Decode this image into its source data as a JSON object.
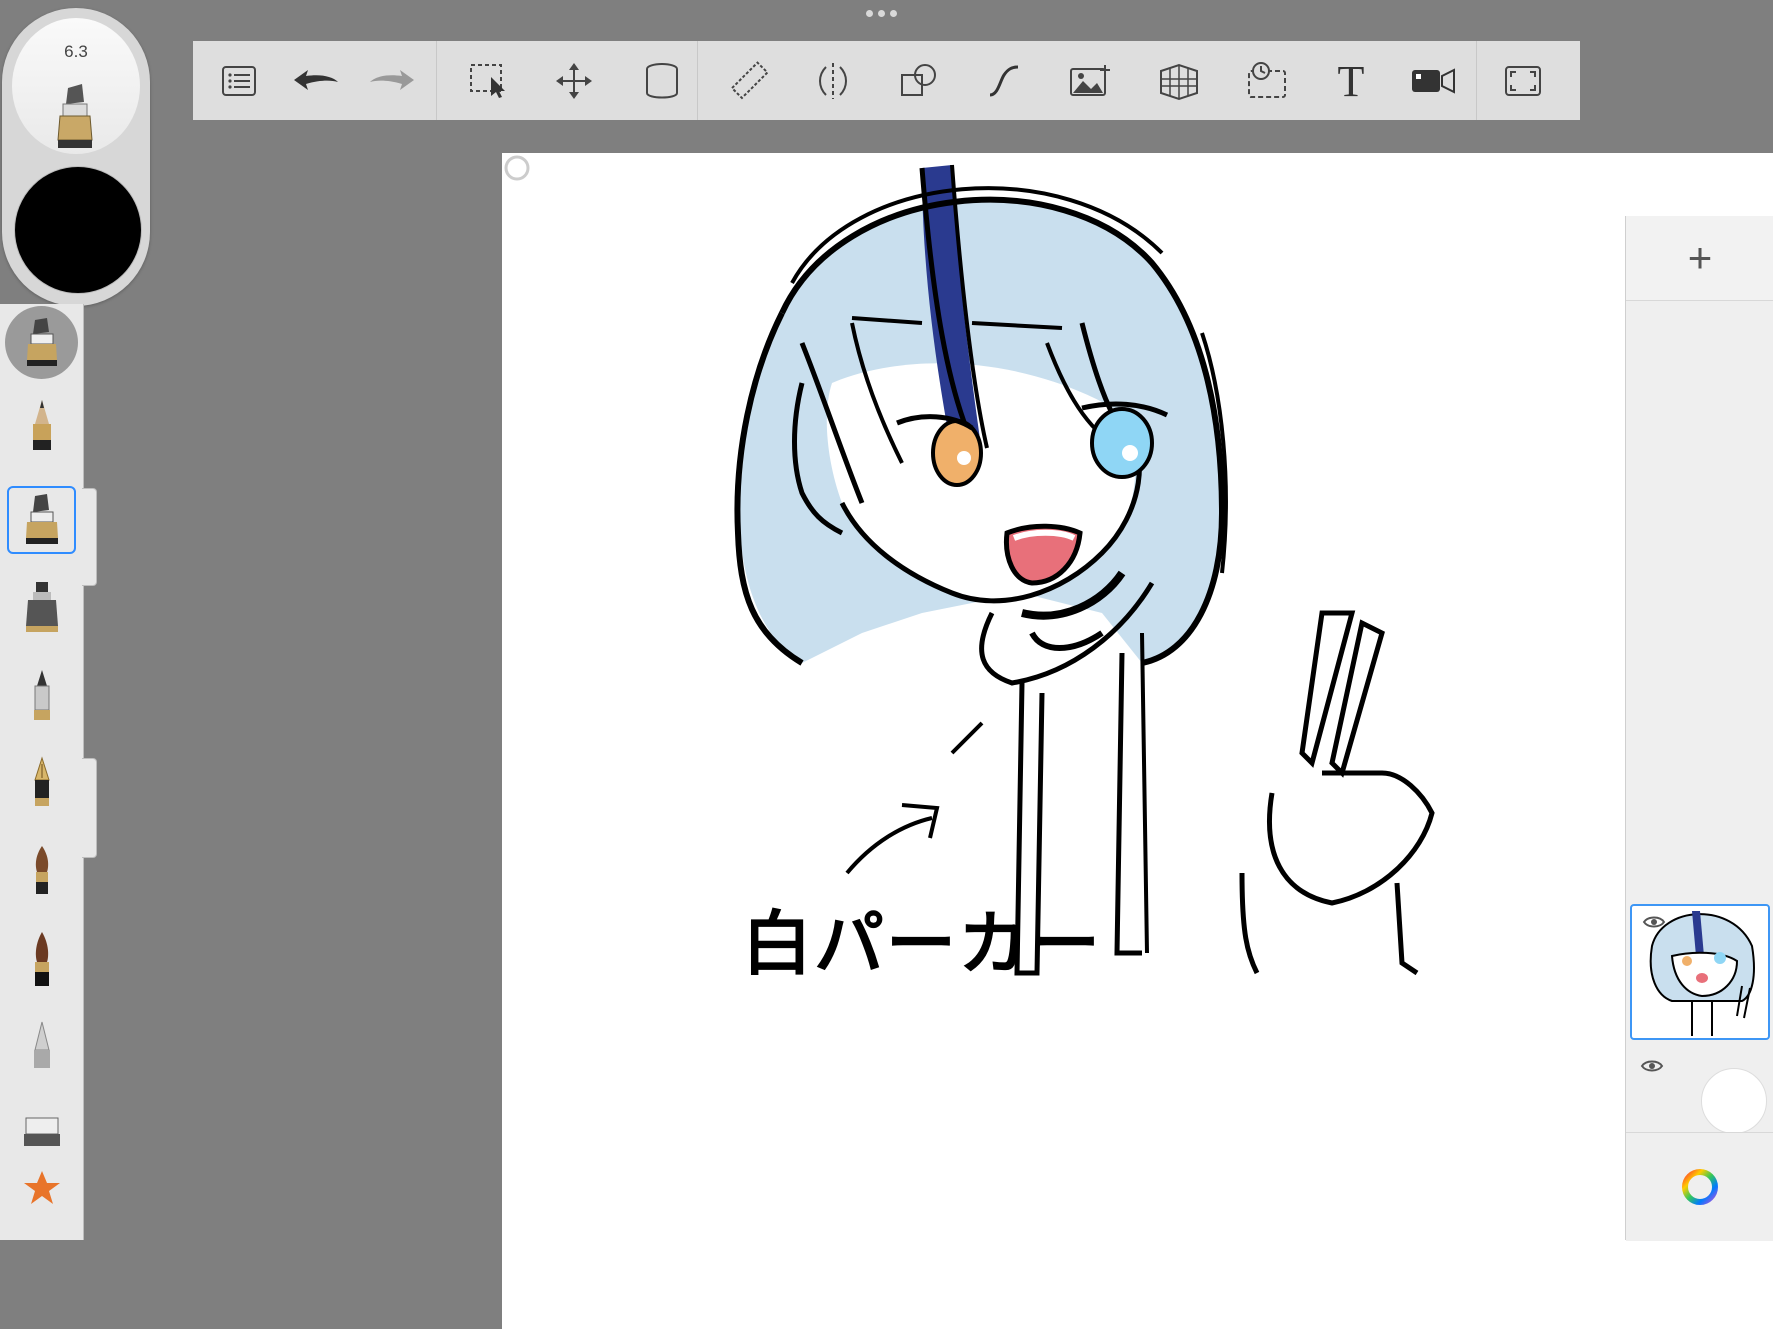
{
  "app": {
    "menu_dots": "more-options"
  },
  "brush_puck": {
    "size_value": "6.3",
    "current_color": "#000000"
  },
  "toolbar": {
    "tools": [
      {
        "name": "list-menu-icon"
      },
      {
        "name": "undo-icon"
      },
      {
        "name": "redo-icon"
      },
      {
        "name": "selection-icon"
      },
      {
        "name": "transform-icon"
      },
      {
        "name": "fill-bucket-icon"
      },
      {
        "name": "ruler-icon"
      },
      {
        "name": "symmetry-icon"
      },
      {
        "name": "shapes-icon"
      },
      {
        "name": "stroke-style-icon"
      },
      {
        "name": "import-image-icon"
      },
      {
        "name": "perspective-grid-icon"
      },
      {
        "name": "time-lapse-icon"
      },
      {
        "name": "text-icon"
      },
      {
        "name": "record-icon"
      },
      {
        "name": "fullscreen-icon"
      }
    ],
    "text_tool_glyph": "T"
  },
  "palette": {
    "brushes": [
      "pencil",
      "marker-selected",
      "airbrush",
      "ballpoint-pen",
      "fountain-pen",
      "paint-brush",
      "ink-brush",
      "soft-pencil",
      "eraser",
      "favorites-star"
    ],
    "selected_index": 1
  },
  "canvas": {
    "annotation_text": "白パーカー",
    "colors": {
      "hair": "#c9dfee",
      "hair_streak": "#2a3a8f",
      "eye_left": "#f0b06a",
      "eye_right": "#8fd6f5",
      "mouth": "#e8707a",
      "line": "#000000"
    }
  },
  "layers": {
    "add_label": "+",
    "items": [
      {
        "name": "layer-1",
        "visible": true,
        "selected": true
      },
      {
        "name": "base-layer",
        "visible": true,
        "selected": false
      }
    ]
  }
}
